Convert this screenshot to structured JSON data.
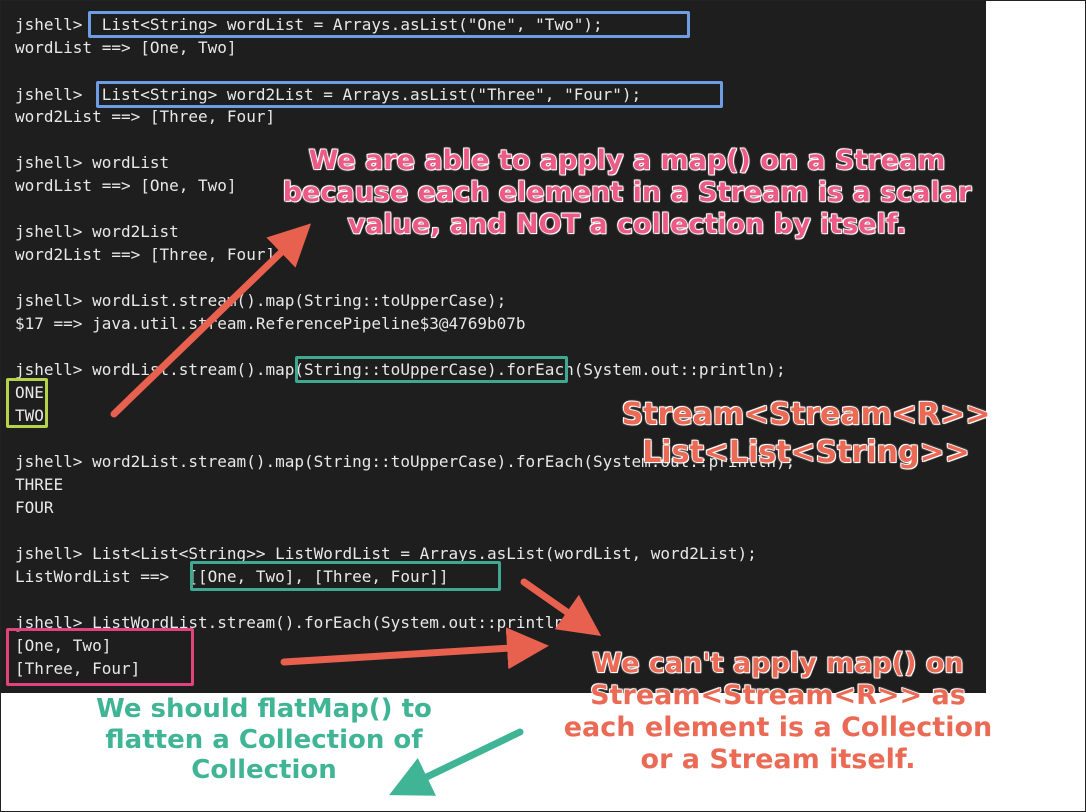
{
  "terminal": {
    "lines": [
      "jshell>  List<String> wordList = Arrays.asList(\"One\", \"Two\");",
      "wordList ==> [One, Two]",
      "jshell>  List<String> word2List = Arrays.asList(\"Three\", \"Four\");",
      "word2List ==> [Three, Four]",
      "jshell> wordList",
      "wordList ==> [One, Two]",
      "jshell> word2List",
      "word2List ==> [Three, Four]",
      "jshell> wordList.stream().map(String::toUpperCase);",
      "$17 ==> java.util.stream.ReferencePipeline$3@4769b07b",
      "jshell> wordList.stream().map(String::toUpperCase).forEach(System.out::println);",
      "ONE",
      "TWO",
      "jshell> word2List.stream().map(String::toUpperCase).forEach(System.out::println);",
      "THREE",
      "FOUR",
      "jshell> List<List<String>> ListWordList = Arrays.asList(wordList, word2List);",
      "ListWordList ==>  [[One, Two], [Three, Four]]",
      "jshell> ListWordList.stream().forEach(System.out::println);",
      "[One, Two]",
      "[Three, Four]"
    ]
  },
  "annotations": {
    "map_explanation": "We are able to apply a map() on a Stream because each element in a Stream is a scalar value, and NOT a collection by itself.",
    "type_line1": "Stream<Stream<R>>",
    "type_line2": "List<List<String>>",
    "cant_map": "We can't apply map() on Stream<Stream<R>> as each element is a Collection or a Stream itself.",
    "flatmap_hint": "We should flatMap() to flatten a Collection of Collection"
  },
  "colors": {
    "terminal_bg": "#1e1e1e",
    "terminal_text": "#e8e8e8",
    "box_blue": "#6f9de3",
    "box_teal": "#3fa890",
    "box_lime": "#b6d24a",
    "box_pink": "#e0447a",
    "note_pink": "#ec5a86",
    "note_orange": "#ea6a55",
    "note_teal": "#3fb596",
    "arrow": "#e8604e",
    "arrow_teal": "#3fb596"
  }
}
